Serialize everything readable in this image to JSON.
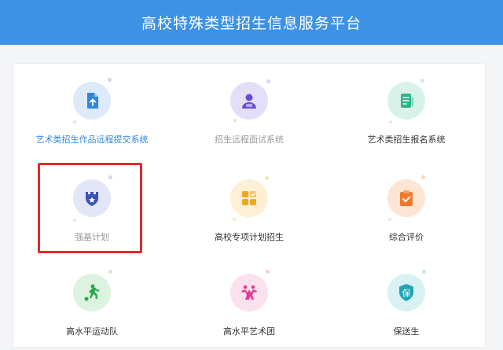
{
  "header": {
    "title": "高校特殊类型招生信息服务平台"
  },
  "tiles": [
    {
      "label": "艺术类招生作品远程提交系统",
      "icon": "upload-file-icon",
      "bg": "#dceaf9",
      "fg": "#2f86e0",
      "label_color": "#2f86e0"
    },
    {
      "label": "招生远程面试系统",
      "icon": "interview-person-icon",
      "bg": "#e5def8",
      "fg": "#6a4bd4",
      "label_color": "#999999"
    },
    {
      "label": "艺术类招生报名系统",
      "icon": "registration-form-icon",
      "bg": "#d8f2ea",
      "fg": "#2fb38a",
      "label_color": "#333333"
    },
    {
      "label": "强基计划",
      "icon": "star-castle-icon",
      "bg": "#e2e6f7",
      "fg": "#3c52b8",
      "label_color": "#999999"
    },
    {
      "label": "高校专项计划招生",
      "icon": "grid-check-icon",
      "bg": "#fdf0d4",
      "fg": "#f2a81c",
      "label_color": "#333333"
    },
    {
      "label": "综合评价",
      "icon": "clipboard-check-icon",
      "bg": "#fde5d5",
      "fg": "#f07a2a",
      "label_color": "#333333"
    },
    {
      "label": "高水平运动队",
      "icon": "soccer-player-icon",
      "bg": "#dcf3e2",
      "fg": "#28a84a",
      "label_color": "#333333"
    },
    {
      "label": "高水平艺术团",
      "icon": "dancers-icon",
      "bg": "#fbe0ee",
      "fg": "#e23a90",
      "label_color": "#333333"
    },
    {
      "label": "保送生",
      "icon": "bao-badge-icon",
      "bg": "#d9f1f3",
      "fg": "#1fa5b3",
      "label_color": "#333333",
      "glyph": "保"
    }
  ],
  "highlight": {
    "target": "强基计划",
    "color": "#e02a2a"
  }
}
